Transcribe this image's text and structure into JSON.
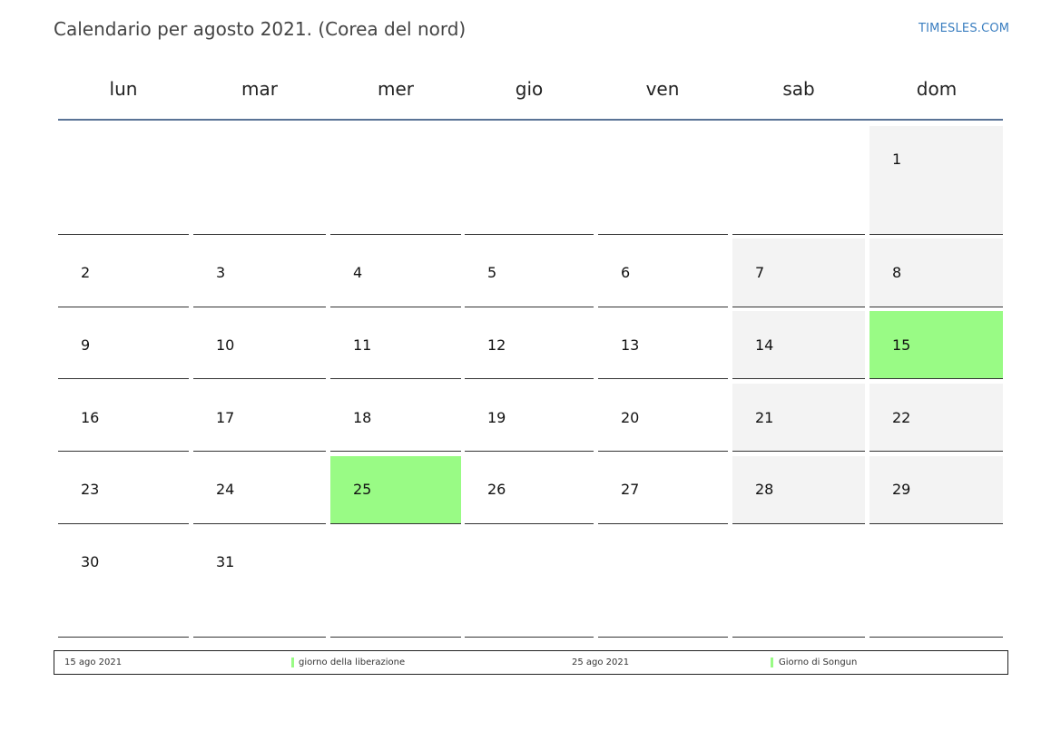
{
  "header": {
    "title": "Calendario per agosto 2021. (Corea del nord)",
    "site": "TIMESLES.COM"
  },
  "colors": {
    "holiday": "#99fb85",
    "weekend": "#f3f3f3",
    "header_rule": "#5a7396",
    "site_link": "#3a7ec0"
  },
  "weekdays": [
    "lun",
    "mar",
    "mer",
    "gio",
    "ven",
    "sab",
    "dom"
  ],
  "weeks": [
    [
      null,
      null,
      null,
      null,
      null,
      null,
      "1"
    ],
    [
      "2",
      "3",
      "4",
      "5",
      "6",
      "7",
      "8"
    ],
    [
      "9",
      "10",
      "11",
      "12",
      "13",
      "14",
      "15"
    ],
    [
      "16",
      "17",
      "18",
      "19",
      "20",
      "21",
      "22"
    ],
    [
      "23",
      "24",
      "25",
      "26",
      "27",
      "28",
      "29"
    ],
    [
      "30",
      "31",
      null,
      null,
      null,
      null,
      null
    ]
  ],
  "holiday_days": [
    "15",
    "25"
  ],
  "legend": [
    {
      "date": "15 ago 2021",
      "name": "giorno della liberazione"
    },
    {
      "date": "25 ago 2021",
      "name": "Giorno di Songun"
    }
  ]
}
